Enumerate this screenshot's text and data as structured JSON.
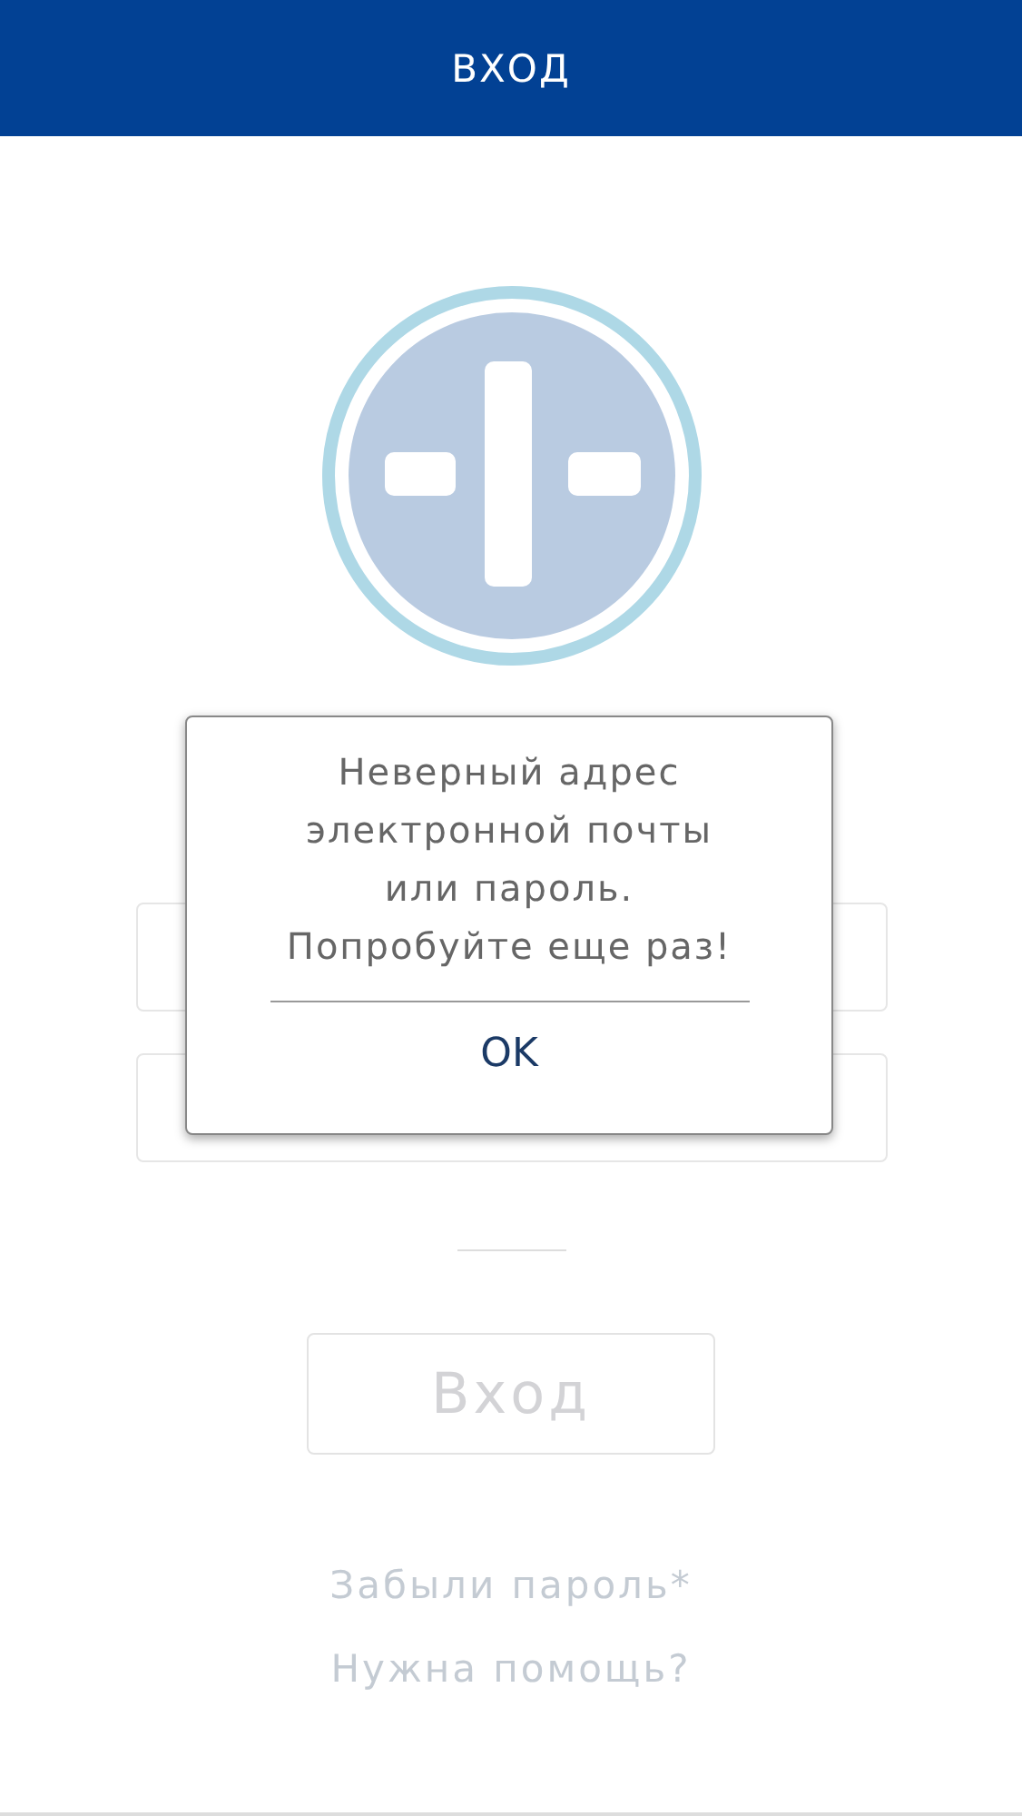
{
  "header": {
    "title": "ВХОД"
  },
  "login_button": {
    "label": "Вход",
    "disabled": true
  },
  "links": [
    "Забыли пароль*",
    "Нужна помощь?"
  ],
  "alert": {
    "message_lines": [
      "Неверный адрес",
      "электронной почты",
      "или пароль.",
      "Попробуйте еще раз!"
    ],
    "button": "OK"
  }
}
